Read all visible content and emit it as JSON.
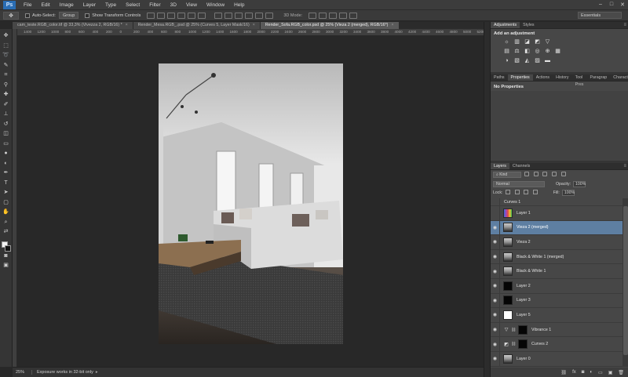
{
  "app": {
    "logo": "Ps"
  },
  "menu": [
    "File",
    "Edit",
    "Image",
    "Layer",
    "Type",
    "Select",
    "Filter",
    "3D",
    "View",
    "Window",
    "Help"
  ],
  "window_controls": [
    "–",
    "□",
    "✕"
  ],
  "options_bar": {
    "auto_select_label": "Auto-Select:",
    "auto_select_value": "Group",
    "show_transform_label": "Show Transform Controls",
    "mode3d_label": "3D Mode:",
    "workspace": "Essentials"
  },
  "doc_tabs": [
    {
      "label": "cam_teste.RGB_color.tif @ 33,3% (Vivezza 2, RGB/16) *",
      "active": false
    },
    {
      "label": "Render_Mesa.RGB_.psd @ 25% (Curves 5, Layer Mask/16)",
      "active": false
    },
    {
      "label": "Render_Sofa.RGB_color.psd @ 25% (Vieza 2 (merged), RGB/16*)",
      "active": true
    }
  ],
  "ruler_ticks": [
    "1400",
    "1200",
    "1000",
    "800",
    "600",
    "400",
    "200",
    "0",
    "200",
    "400",
    "600",
    "800",
    "1000",
    "1200",
    "1400",
    "1600",
    "1800",
    "2000",
    "2200",
    "2400",
    "2600",
    "2800",
    "3000",
    "3200",
    "3400",
    "3600",
    "3800",
    "4000",
    "4200",
    "4400",
    "4600",
    "4800",
    "5000",
    "5200"
  ],
  "status": {
    "zoom": "25%",
    "message": "Exposure works in 32-bit only"
  },
  "adjustments_panel": {
    "tabs": [
      "Adjustments",
      "Styles"
    ],
    "title": "Add an adjustment"
  },
  "properties_panel": {
    "tabs": [
      "Paths",
      "Properties",
      "Actions",
      "History",
      "Tool Pres",
      "Paragrap",
      "Character"
    ],
    "active_tab": "Properties",
    "title": "No Properties"
  },
  "layers_panel": {
    "tabs": [
      "Layers",
      "Channels"
    ],
    "kind_label": "Kind",
    "blend_mode": "Normal",
    "opacity_label": "Opacity:",
    "opacity_value": "100%",
    "lock_label": "Lock:",
    "fill_label": "Fill:",
    "fill_value": "100%",
    "layers": [
      {
        "name": "Curves 1",
        "thumb": "dark",
        "visible": false,
        "partial": true
      },
      {
        "name": "Layer 1",
        "thumb": "color",
        "visible": false
      },
      {
        "name": "Vieza 2 (merged)",
        "thumb": "photo",
        "visible": true,
        "selected": true
      },
      {
        "name": "Vieza 2",
        "thumb": "photo",
        "visible": true
      },
      {
        "name": "Black & White 1 (merged)",
        "thumb": "photo",
        "visible": true
      },
      {
        "name": "Black & White 1",
        "thumb": "photo",
        "visible": true
      },
      {
        "name": "Layer 2",
        "thumb": "black",
        "visible": true
      },
      {
        "name": "Layer 3",
        "thumb": "black",
        "visible": true
      },
      {
        "name": "Layer 5",
        "thumb": "white",
        "visible": true
      },
      {
        "name": "Vibrance 1",
        "thumb": "black",
        "visible": true,
        "adjustment": "▽"
      },
      {
        "name": "Curves 2",
        "thumb": "black",
        "visible": true,
        "adjustment": "◩"
      },
      {
        "name": "Layer 0",
        "thumb": "photo",
        "visible": true
      }
    ],
    "footer_icons": [
      "link-icon",
      "fx-icon",
      "mask-icon",
      "adjustment-icon",
      "folder-icon",
      "new-layer-icon",
      "trash-icon"
    ]
  }
}
